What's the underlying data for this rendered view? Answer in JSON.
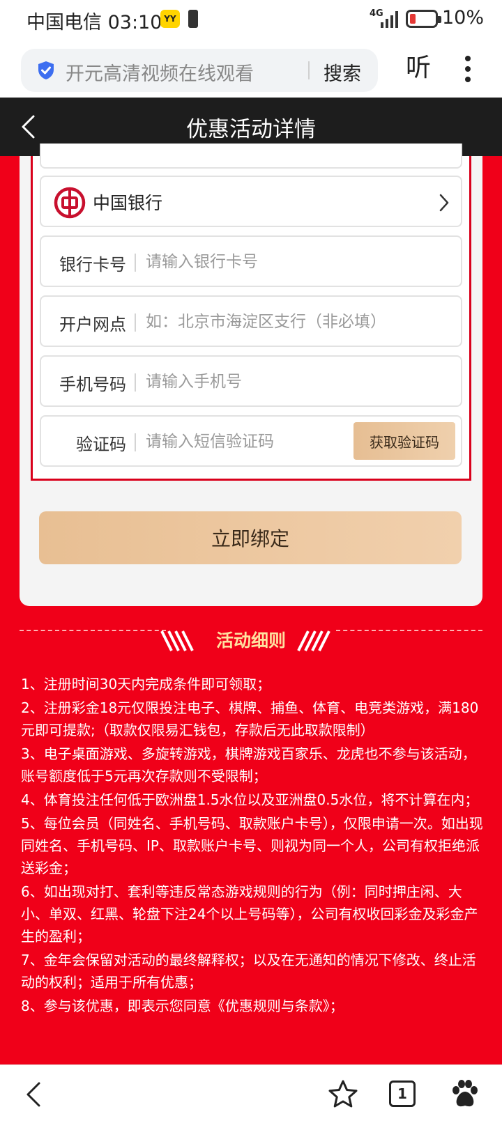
{
  "status_bar": {
    "carrier_time": "中国电信 03:10",
    "app_badge": "YY",
    "network": "4G",
    "battery": "10%"
  },
  "browser": {
    "query": "开元高清视频在线观看",
    "search_button": "搜索",
    "listen_label": "听"
  },
  "header": {
    "title": "优惠活动详情"
  },
  "form": {
    "bank_name": "中国银行",
    "card_label": "银行卡号",
    "card_placeholder": "请输入银行卡号",
    "branch_label": "开户网点",
    "branch_placeholder": "如：北京市海淀区支行（非必填）",
    "phone_label": "手机号码",
    "phone_placeholder": "请输入手机号",
    "code_label": "验证码",
    "code_placeholder": "请输入短信验证码",
    "get_code_button": "获取验证码",
    "submit_button": "立即绑定"
  },
  "rules": {
    "title": "活动细则",
    "items": [
      "1、注册时间30天内完成条件即可领取；",
      "2、注册彩金18元仅限投注电子、棋牌、捕鱼、体育、电竞类游戏，满180元即可提款;（取款仅限易汇钱包，存款后无此取款限制）",
      "3、电子桌面游戏、多旋转游戏，棋牌游戏百家乐、龙虎也不参与该活动，账号额度低于5元再次存款则不受限制；",
      "4、体育投注任何低于欧洲盘1.5水位以及亚洲盘0.5水位，将不计算在内；",
      "5、每位会员（同姓名、手机号码、取款账户卡号），仅限申请一次。如出现同姓名、手机号码、IP、取款账户卡号、则视为同一个人，公司有权拒绝派送彩金；",
      "6、如出现对打、套利等违反常态游戏规则的行为（例：同时押庄闲、大小、单双、红黑、轮盘下注24个以上号码等），公司有权收回彩金及彩金产生的盈利；",
      "7、金年会保留对活动的最终解释权；以及在无通知的情况下修改、终止活动的权利；适用于所有优惠；",
      "8、参与该优惠，即表示您同意《优惠规则与条款》；"
    ]
  },
  "bottom_nav": {
    "tab_count": "1"
  },
  "icons": [
    "shield-icon",
    "more-icon",
    "back-icon",
    "bank-of-china-icon",
    "chevron-right-icon",
    "star-icon",
    "tabs-icon",
    "baidu-paw-icon"
  ],
  "colors": {
    "page_red": "#f00019",
    "header_dark": "#1d1d1d",
    "button_gold": "#e8bf93",
    "rules_title": "#ffe0a0"
  }
}
